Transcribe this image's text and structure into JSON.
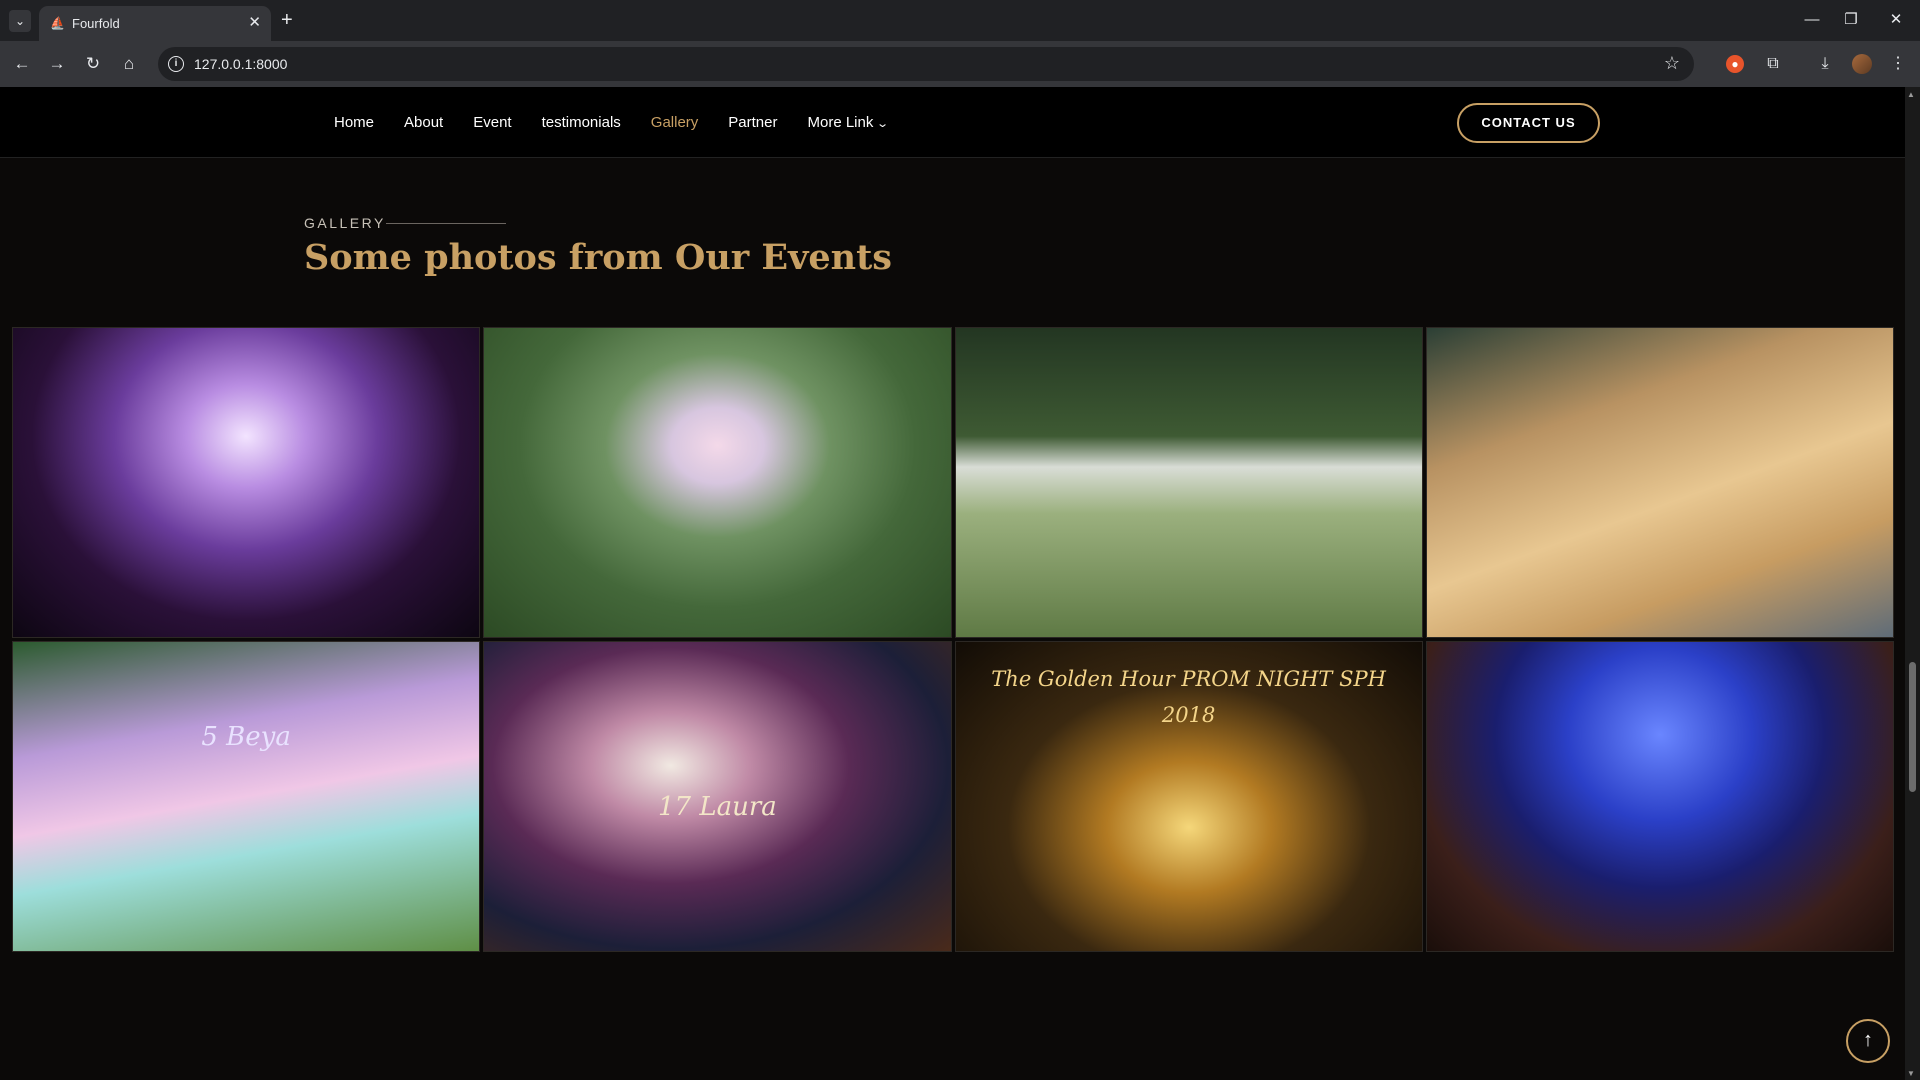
{
  "browser": {
    "tab_title": "Fourfold",
    "url": "127.0.0.1:8000"
  },
  "nav": {
    "links": [
      "Home",
      "About",
      "Event",
      "testimonials",
      "Gallery",
      "Partner",
      "More Link"
    ],
    "active": "Gallery",
    "contact_label": "CONTACT US"
  },
  "gallery": {
    "eyebrow": "GALLERY",
    "heading": "Some photos from Our Events",
    "photos": [
      {
        "caption": ""
      },
      {
        "caption": ""
      },
      {
        "caption": ""
      },
      {
        "caption": ""
      },
      {
        "caption": "5 Beya"
      },
      {
        "caption": "17 Laura"
      },
      {
        "caption": "The Golden Hour PROM NIGHT SPH 2018"
      },
      {
        "caption": ""
      }
    ]
  },
  "colors": {
    "accent": "#c8a064",
    "background": "#0b0908",
    "nav_background": "#000000"
  },
  "icons": [
    "tab-list-icon",
    "favicon-icon",
    "close-tab-icon",
    "new-tab-icon",
    "back-icon",
    "forward-icon",
    "reload-icon",
    "home-icon",
    "site-info-icon",
    "bookmark-star-icon",
    "extension-icon",
    "puzzle-icon",
    "download-icon",
    "profile-avatar",
    "kebab-menu-icon",
    "chevron-down-icon",
    "arrow-up-icon"
  ]
}
